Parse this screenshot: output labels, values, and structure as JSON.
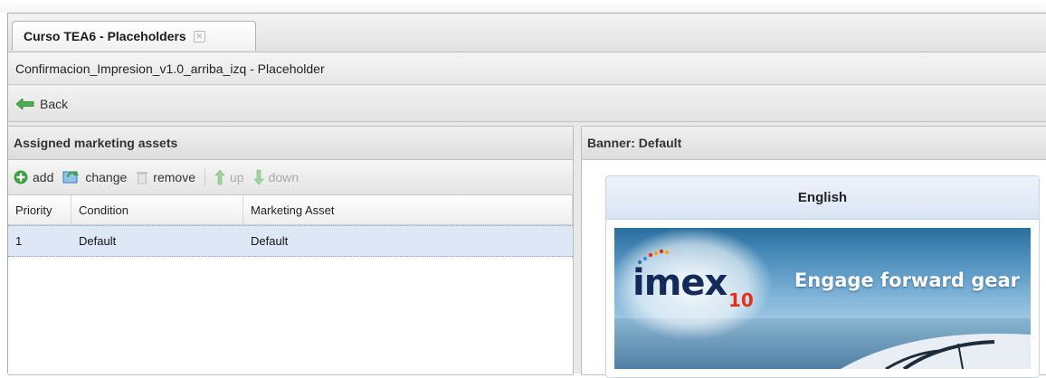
{
  "tab": {
    "title": "Curso TEA6 - Placeholders",
    "close_glyph": "✕"
  },
  "titlebar": {
    "title": "Confirmacion_Impresion_v1.0_arriba_izq - Placeholder"
  },
  "backbar": {
    "back_label": "Back"
  },
  "left_panel": {
    "title": "Assigned marketing assets",
    "toolbar": {
      "add": "add",
      "change": "change",
      "remove": "remove",
      "up": "up",
      "down": "down"
    },
    "columns": [
      "Priority",
      "Condition",
      "Marketing Asset"
    ],
    "rows": [
      {
        "priority": "1",
        "condition": "Default",
        "asset": "Default"
      }
    ]
  },
  "right_panel": {
    "title": "Banner: Default",
    "banner": {
      "language": "English",
      "logo": "imex",
      "logo_sub": "10",
      "tagline": "Engage forward gear"
    }
  },
  "colors": {
    "accent_selected_row": "#dde7f5",
    "add_icon": "#3fa142",
    "arrow_icon": "#5cb85c"
  },
  "icons": {
    "close": "close-icon",
    "back": "back-arrow-icon",
    "add": "add-circle-icon",
    "change": "change-refresh-icon",
    "remove": "trash-icon",
    "up": "arrow-up-icon",
    "down": "arrow-down-icon"
  }
}
